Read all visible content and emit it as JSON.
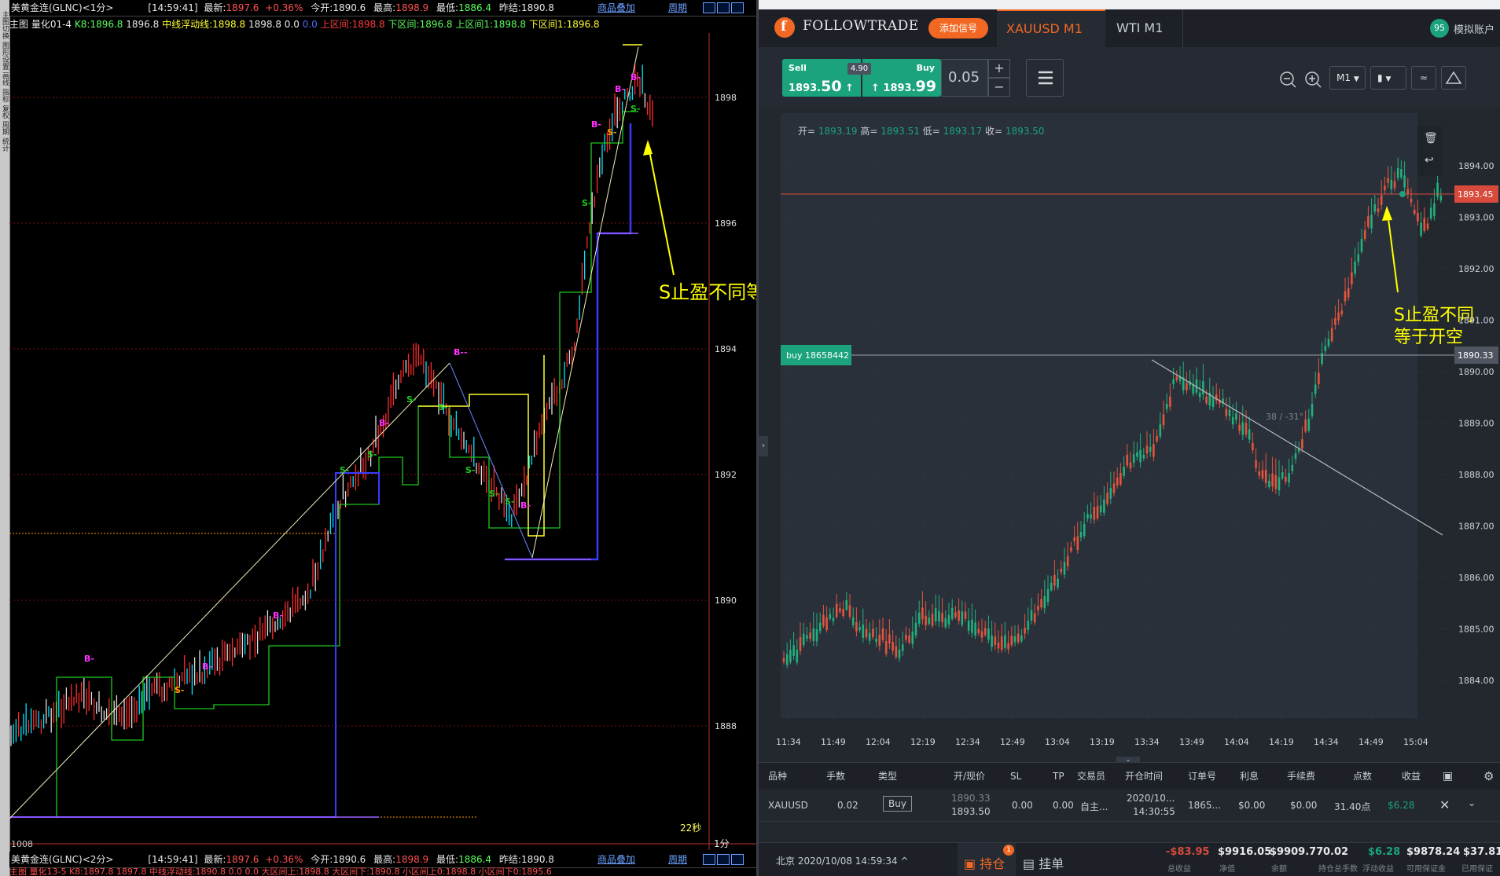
{
  "left_panel": {
    "strip_text": "主图切换 图形设置 画线 指标 复权 周期 统计",
    "top_header": {
      "symbol": "美黄金连(GLNC)<1分>",
      "time": "[14:59:41]",
      "latest_label": "最新:",
      "latest": "1897.6",
      "change": "+0.36%",
      "open_label": "今开:",
      "open": "1890.6",
      "high_label": "最高:",
      "high": "1898.9",
      "low_label": "最低:",
      "low": "1886.4",
      "prev_label": "昨结:",
      "prev": "1890.8",
      "link": "商品叠加",
      "period": "周期"
    },
    "top_indicator": {
      "prefix": "主图 量化01-4",
      "k8": "K8:1896.8",
      "k8b": "1896.8",
      "mid": "中线浮动线:1898.8",
      "mid2": "1898.8",
      "zero1": "0.0",
      "zero2": "0.0",
      "up": "上区间:1898.8",
      "down": "下区间:1896.8",
      "up1": "上区间1:1898.8",
      "down1": "下区间1:1896.8"
    },
    "price_axis": [
      "1898",
      "1896",
      "1894",
      "1892",
      "1890",
      "1888"
    ],
    "bottom_left_label": "1008",
    "timer": "22秒",
    "period_label": "1分",
    "annotation": "S止盈不同等于开空",
    "bottom_header": {
      "symbol": "美黄金连(GLNC)<2分>",
      "time": "[14:59:41]",
      "latest_label": "最新:",
      "latest": "1897.6",
      "change": "+0.36%",
      "open_label": "今开:",
      "open": "1890.6",
      "high_label": "最高:",
      "high": "1898.9",
      "low_label": "最低:",
      "low": "1886.4",
      "prev_label": "昨结:",
      "prev": "1890.8",
      "link": "商品叠加",
      "period": "周期"
    },
    "bottom_indicator": "主图 量化13-5 K8:1897.8 1897.8 中线浮动线:1890.8 0.0 0.0 大区间上:1898.8 大区间下:1890.8 小区间上0:1898.8 小区间下0:1895.6"
  },
  "right_panel": {
    "brand": "FOLLOWTRADE",
    "add_signal": "添加信号",
    "tabs": [
      "XAUUSD M1",
      "WTI M1"
    ],
    "account_badge": "95",
    "account_label": "模拟账户",
    "sell_label": "Sell",
    "sell_price_main": "1893.",
    "sell_price_big": "50",
    "spread": "4.90",
    "buy_label": "Buy",
    "buy_price_main": "1893.",
    "buy_price_big": "99",
    "lot": "0.05",
    "timeframe": "M1",
    "ohlc": {
      "open_label": "开=",
      "open": "1893.19",
      "high_label": "高=",
      "high": "1893.51",
      "low_label": "低=",
      "low": "1893.17",
      "close_label": "收=",
      "close": "1893.50"
    },
    "price_axis": [
      "1894.00",
      "1893.00",
      "1892.00",
      "1891.00",
      "1890.00",
      "1889.00",
      "1888.00",
      "1887.00",
      "1886.00",
      "1885.00",
      "1884.00"
    ],
    "current_price_tag": "1893.45",
    "buy_line_label": "buy 18658442",
    "buy_line_price": "1890.33",
    "trendline_label": "38 / -31°",
    "annotation_line1": "S止盈不同",
    "annotation_line2": "等于开空",
    "time_axis": [
      "11:34",
      "11:49",
      "12:04",
      "12:19",
      "12:34",
      "12:49",
      "13:04",
      "13:19",
      "13:34",
      "13:49",
      "14:04",
      "14:19",
      "14:34",
      "14:49",
      "15:04"
    ],
    "table": {
      "headers": [
        "品种",
        "手数",
        "类型",
        "开/现价",
        "SL",
        "TP",
        "交易员",
        "开仓时间",
        "订单号",
        "利息",
        "手续费",
        "点数",
        "收益"
      ],
      "row": {
        "symbol": "XAUUSD",
        "lots": "0.02",
        "type": "Buy",
        "open_price": "1890.33",
        "current_price": "1893.50",
        "sl": "0.00",
        "tp": "0.00",
        "trader": "自主...",
        "open_date": "2020/10...",
        "open_time": "14:30:55",
        "order": "1865...",
        "interest": "$0.00",
        "fee": "$0.00",
        "points": "31.40点",
        "profit": "$6.28"
      }
    },
    "footer": {
      "datetime": "北京 2020/10/08 14:59:34",
      "tab_positions": "持仓",
      "positions_badge": "1",
      "tab_orders": "挂单",
      "total_profit": "-$83.95",
      "total_profit_label": "总收益",
      "equity": "$9916.05",
      "equity_label": "净值",
      "balance": "$9909.77",
      "balance_label": "余额",
      "position_lots": "0.02",
      "position_lots_label": "持仓总手数",
      "floating": "$6.28",
      "floating_label": "浮动收益",
      "free_margin": "$9878.24",
      "free_margin_label": "可用保证金",
      "used_margin": "$37.81",
      "used_margin_label": "已用保证"
    },
    "colors": {
      "accent_orange": "#f26722",
      "buy_green": "#1aa37c",
      "price_red": "#d84a3c"
    }
  }
}
